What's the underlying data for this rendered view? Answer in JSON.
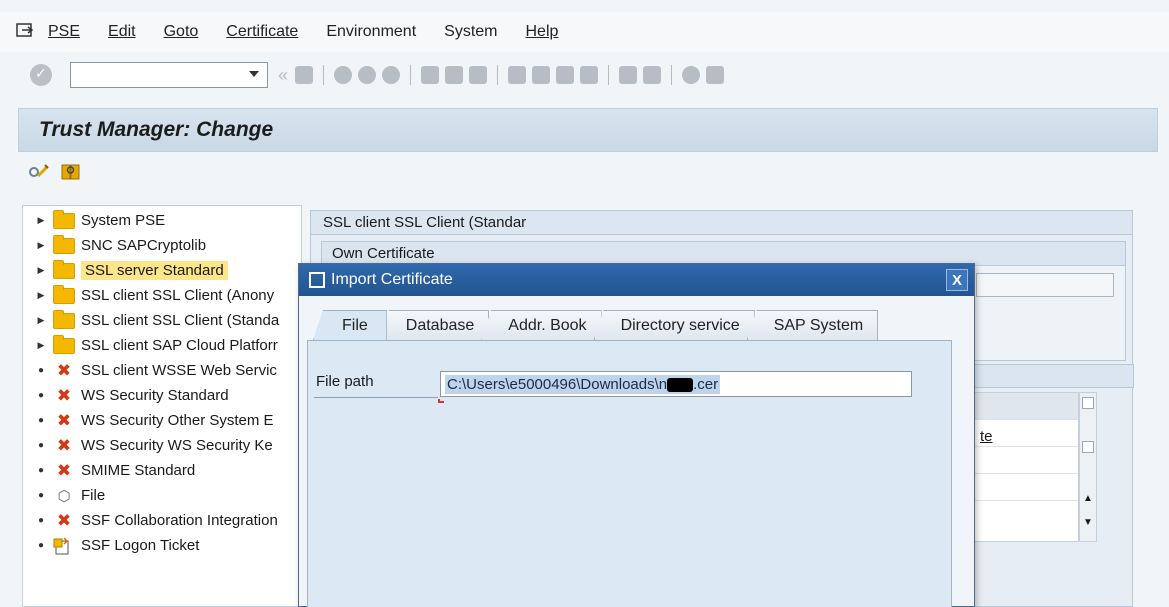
{
  "menu": {
    "items": [
      {
        "label": "PSE"
      },
      {
        "label": "Edit"
      },
      {
        "label": "Goto"
      },
      {
        "label": "Certificate"
      },
      {
        "label": "Environment"
      },
      {
        "label": "System"
      },
      {
        "label": "Help"
      }
    ]
  },
  "toolbar": {
    "command_field_value": ""
  },
  "title": "Trust Manager: Change",
  "tree": {
    "items": [
      {
        "label": "System PSE",
        "type": "folder"
      },
      {
        "label": "SNC SAPCryptolib",
        "type": "folder"
      },
      {
        "label": "SSL server Standard",
        "type": "folder",
        "selected": true
      },
      {
        "label": "SSL client SSL Client (Anony",
        "type": "folder"
      },
      {
        "label": "SSL client SSL Client (Standa",
        "type": "folder"
      },
      {
        "label": "SSL client SAP Cloud Platforr",
        "type": "folder"
      },
      {
        "label": "SSL client WSSE Web Servic",
        "type": "x"
      },
      {
        "label": "WS Security Standard",
        "type": "x"
      },
      {
        "label": "WS Security Other System E",
        "type": "x"
      },
      {
        "label": "WS Security WS Security Ke",
        "type": "x"
      },
      {
        "label": "SMIME Standard",
        "type": "x"
      },
      {
        "label": "File",
        "type": "file"
      },
      {
        "label": "SSF Collaboration Integration",
        "type": "x"
      },
      {
        "label": "SSF Logon Ticket",
        "type": "ticket"
      }
    ]
  },
  "right_panel": {
    "title": "SSL client SSL Client (Standar",
    "own_certificate": "Own Certificate",
    "link_fragment": "te"
  },
  "dialog": {
    "title": "Import Certificate",
    "close_label": "X",
    "tabs": [
      {
        "label": "File"
      },
      {
        "label": "Database"
      },
      {
        "label": "Addr. Book"
      },
      {
        "label": "Directory service"
      },
      {
        "label": "SAP System"
      }
    ],
    "file_path_label": "File path",
    "file_path_value_prefix": "C:\\Users\\e5000496\\Downloads\\n",
    "file_path_value_suffix": ".cer"
  },
  "colors": {
    "dialog_title_bg": "#2f69ad",
    "folder": "#f5b800",
    "error_x": "#d33a12",
    "selected_item_bg": "#fde58a"
  }
}
